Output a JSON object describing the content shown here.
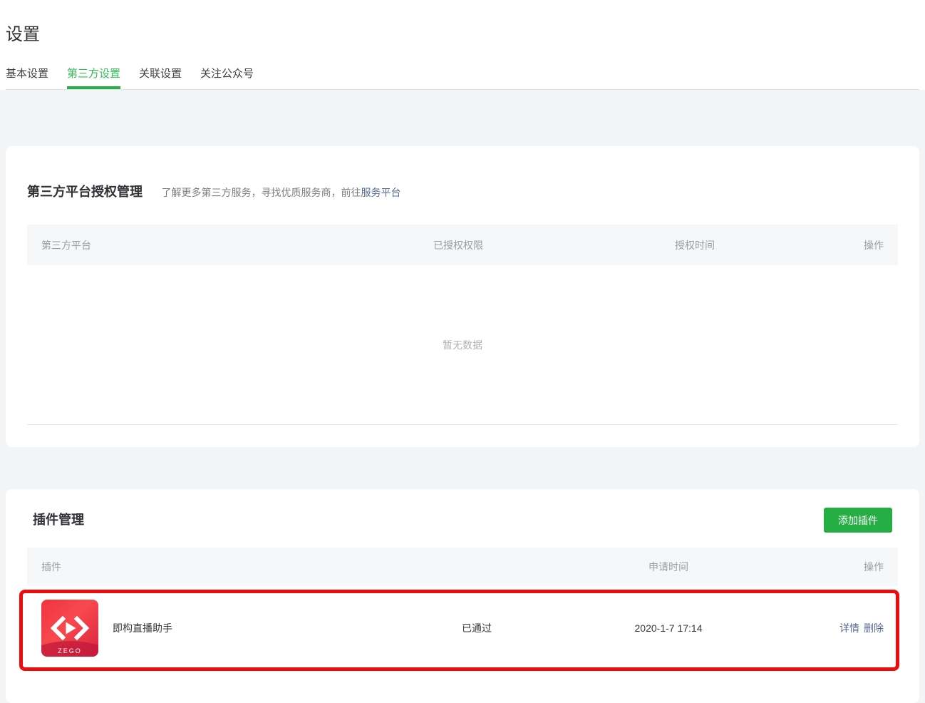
{
  "page": {
    "title": "设置"
  },
  "tabs": [
    {
      "label": "基本设置",
      "active": false
    },
    {
      "label": "第三方设置",
      "active": true
    },
    {
      "label": "关联设置",
      "active": false
    },
    {
      "label": "关注公众号",
      "active": false
    }
  ],
  "auth_card": {
    "title": "第三方平台授权管理",
    "hint_text": "了解更多第三方服务，寻找优质服务商，前往",
    "hint_link": "服务平台",
    "table": {
      "headers": [
        "第三方平台",
        "已授权权限",
        "授权时间",
        "操作"
      ],
      "empty_text": "暂无数据"
    }
  },
  "plugin_card": {
    "title": "插件管理",
    "add_button": "添加插件",
    "table": {
      "headers": [
        "插件",
        "申请时间",
        "操作"
      ]
    },
    "rows": [
      {
        "icon": "zego-logo",
        "icon_text": "ZEGO",
        "name": "即构直播助手",
        "status": "已通过",
        "apply_time": "2020-1-7 17:14",
        "actions": [
          "详情",
          "删除"
        ]
      }
    ]
  },
  "colors": {
    "accent_green": "#24ae43",
    "active_tab_green": "#35bb58",
    "link_blue": "#576b95",
    "annotation_red": "#ee0b0b",
    "page_background": "#f3f4f6",
    "table_header_bg": "#f6f7f9",
    "zego_red_start": "#ef3340",
    "zego_red_mid": "#f8494e",
    "zego_red_end": "#d92240"
  }
}
